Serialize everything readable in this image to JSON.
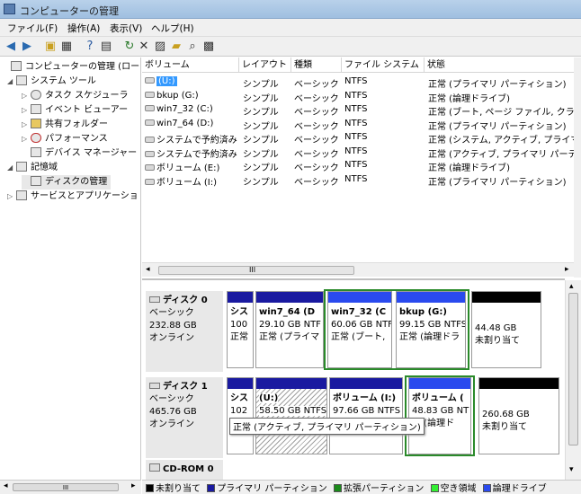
{
  "window": {
    "title": "コンピューターの管理"
  },
  "menu": [
    "ファイル(F)",
    "操作(A)",
    "表示(V)",
    "ヘルプ(H)"
  ],
  "toolbar_icons": [
    "back-icon",
    "forward-icon",
    "folder-up-icon",
    "console-tree-icon",
    "help-icon",
    "show-hide-icon",
    "refresh-icon",
    "delete-icon",
    "properties-icon",
    "open-icon",
    "search-icon",
    "export-icon"
  ],
  "tree": {
    "items": [
      {
        "label": "コンピューターの管理 (ローカ",
        "icon": "computer-icon"
      },
      {
        "label": "システム ツール",
        "icon": "tools-icon"
      },
      {
        "label": "タスク スケジューラ",
        "icon": "clock-icon"
      },
      {
        "label": "イベント ビューアー",
        "icon": "event-icon"
      },
      {
        "label": "共有フォルダー",
        "icon": "shared-folder-icon"
      },
      {
        "label": "パフォーマンス",
        "icon": "performance-icon"
      },
      {
        "label": "デバイス マネージャー",
        "icon": "device-icon"
      },
      {
        "label": "記憶域",
        "icon": "storage-icon"
      },
      {
        "label": "ディスクの管理",
        "icon": "disk-icon"
      },
      {
        "label": "サービスとアプリケーショ",
        "icon": "services-icon"
      }
    ],
    "scroll_label": "III"
  },
  "volumes": {
    "columns": [
      "ボリューム",
      "レイアウト",
      "種類",
      "ファイル システム",
      "状態"
    ],
    "rows": [
      {
        "name": "(U:)",
        "layout": "シンプル",
        "type": "ベーシック",
        "fs": "NTFS",
        "status": "正常 (プライマリ パーティション)"
      },
      {
        "name": "bkup (G:)",
        "layout": "シンプル",
        "type": "ベーシック",
        "fs": "NTFS",
        "status": "正常 (論理ドライブ)"
      },
      {
        "name": "win7_32 (C:)",
        "layout": "シンプル",
        "type": "ベーシック",
        "fs": "NTFS",
        "status": "正常 (ブート, ページ ファイル, クラ"
      },
      {
        "name": "win7_64 (D:)",
        "layout": "シンプル",
        "type": "ベーシック",
        "fs": "NTFS",
        "status": "正常 (プライマリ パーティション)"
      },
      {
        "name": "システムで予約済み",
        "layout": "シンプル",
        "type": "ベーシック",
        "fs": "NTFS",
        "status": "正常 (システム, アクティブ, プライマ"
      },
      {
        "name": "システムで予約済み",
        "layout": "シンプル",
        "type": "ベーシック",
        "fs": "NTFS",
        "status": "正常 (アクティブ, プライマリ パーテ"
      },
      {
        "name": "ボリューム (E:)",
        "layout": "シンプル",
        "type": "ベーシック",
        "fs": "NTFS",
        "status": "正常 (論理ドライブ)"
      },
      {
        "name": "ボリューム (I:)",
        "layout": "シンプル",
        "type": "ベーシック",
        "fs": "NTFS",
        "status": "正常 (プライマリ パーティション)"
      }
    ],
    "scroll_label": "III"
  },
  "disks": [
    {
      "name": "ディスク 0",
      "kind": "ベーシック",
      "size": "232.88 GB",
      "state": "オンライン",
      "parts": [
        {
          "l1": "シス",
          "l2": "100",
          "l3": "正常"
        },
        {
          "l1": "win7_64 (D",
          "l2": "29.10 GB NTF",
          "l3": "正常 (プライマ"
        },
        {
          "l1": "win7_32 (C",
          "l2": "60.06 GB NTF",
          "l3": "正常 (ブート, "
        },
        {
          "l1": "bkup (G:)",
          "l2": "99.15 GB NTFS",
          "l3": "正常 (論理ドラ"
        },
        {
          "l1": "",
          "l2": "44.48 GB",
          "l3": "未割り当て"
        }
      ]
    },
    {
      "name": "ディスク 1",
      "kind": "ベーシック",
      "size": "465.76 GB",
      "state": "オンライン",
      "parts": [
        {
          "l1": "シス",
          "l2": "102",
          "l3": ""
        },
        {
          "l1": "(U:)",
          "l2": "58.50 GB NTFS",
          "l3": ""
        },
        {
          "l1": "ボリューム (I:)",
          "l2": "97.66 GB NTFS",
          "l3": ""
        },
        {
          "l1": "ボリューム (",
          "l2": "48.83 GB NT",
          "l3": "常 (論理ド"
        },
        {
          "l1": "",
          "l2": "260.68 GB",
          "l3": "未割り当て"
        }
      ]
    },
    {
      "name": "CD-ROM 0"
    }
  ],
  "tooltip": "正常 (アクティブ, プライマリ パーティション)",
  "legend": [
    {
      "label": "未割り当て",
      "color": "#000000"
    },
    {
      "label": "プライマリ パーティション",
      "color": "#1a1aa0"
    },
    {
      "label": "拡張パーティション",
      "color": "#1a8a1a"
    },
    {
      "label": "空き領域",
      "color": "#33ee33"
    },
    {
      "label": "論理ドライブ",
      "color": "#2a4aee"
    }
  ]
}
